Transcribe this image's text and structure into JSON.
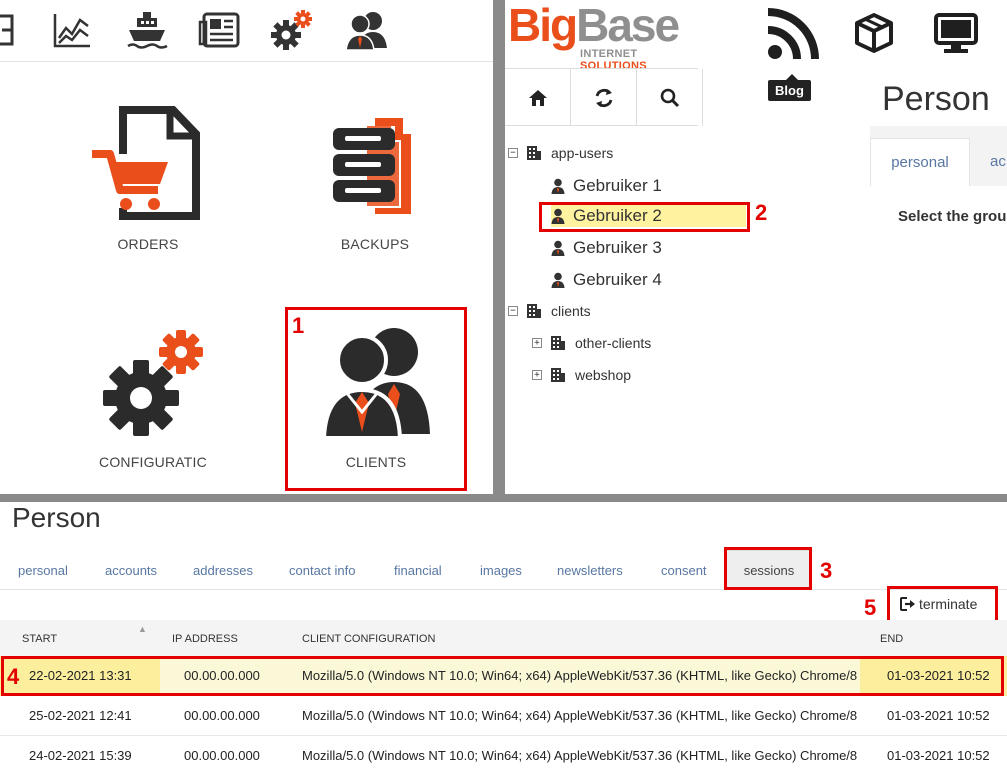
{
  "launcher": {
    "tiles": [
      {
        "label": "ORDERS"
      },
      {
        "label": "BACKUPS"
      },
      {
        "label": "CONFIGURATIC"
      },
      {
        "label": "CLIENTS"
      }
    ],
    "step_clients": "1"
  },
  "header": {
    "logo_big_a": "Big",
    "logo_big_b": "Base",
    "logo_sub_a": "INTERNET ",
    "logo_sub_b": "SOLUTIONS",
    "tooltip": "Blog"
  },
  "tree": {
    "root": "app-users",
    "users": [
      "Gebruiker 1",
      "Gebruiker 2",
      "Gebruiker 3",
      "Gebruiker 4"
    ],
    "clients": "clients",
    "other_clients": "other-clients",
    "webshop": "webshop",
    "step_user": "2"
  },
  "preview": {
    "title": "Person",
    "tab_personal": "personal",
    "tab_accounts": "ac",
    "select_text": "Select the grou"
  },
  "person": {
    "title": "Person",
    "tabs": [
      "personal",
      "accounts",
      "addresses",
      "contact info",
      "financial",
      "images",
      "newsletters",
      "consent"
    ],
    "active_tab": "sessions",
    "step_sessions": "3",
    "terminate_label": "terminate",
    "step_terminate": "5",
    "columns": [
      "START",
      "IP ADDRESS",
      "CLIENT CONFIGURATION",
      "END"
    ],
    "rows": [
      {
        "start": "22-02-2021 13:31",
        "ip": "00.00.00.000",
        "config": "Mozilla/5.0 (Windows NT 10.0; Win64; x64) AppleWebKit/537.36 (KHTML, like Gecko) Chrome/8",
        "end": "01-03-2021 10:52"
      },
      {
        "start": "25-02-2021 12:41",
        "ip": "00.00.00.000",
        "config": "Mozilla/5.0 (Windows NT 10.0; Win64; x64) AppleWebKit/537.36 (KHTML, like Gecko) Chrome/8",
        "end": "01-03-2021 10:52"
      },
      {
        "start": "24-02-2021 15:39",
        "ip": "00.00.00.000",
        "config": "Mozilla/5.0 (Windows NT 10.0; Win64; x64) AppleWebKit/537.36 (KHTML, like Gecko) Chrome/8",
        "end": "01-03-2021 10:52"
      }
    ],
    "step_row": "4"
  },
  "colors": {
    "accent_orange": "#e94e1b",
    "link_blue": "#5877a2",
    "highlight_red": "#e30000",
    "selection_yellow": "#fff3a0"
  },
  "icons": [
    "chart-icon",
    "ship-icon",
    "news-icon",
    "gears-icon",
    "users-icon",
    "rss-icon",
    "box-icon",
    "monitor-icon",
    "home-icon",
    "refresh-icon",
    "search-icon",
    "building-icon",
    "user-icon",
    "terminate-icon"
  ]
}
